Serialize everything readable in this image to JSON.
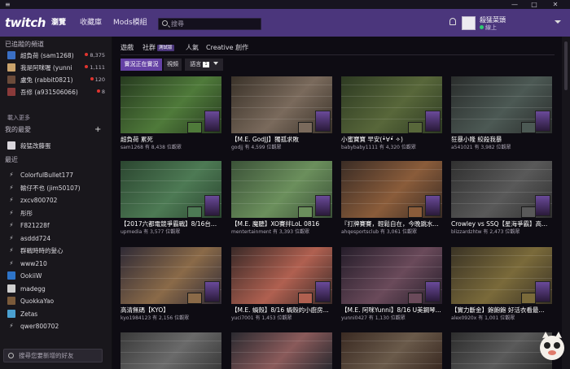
{
  "window": {
    "menu_icon": "≡",
    "minimize": "—",
    "maximize": "□",
    "close": "✕"
  },
  "topnav": {
    "logo": "twitch",
    "links": [
      "瀏覽",
      "收藏庫",
      "Mods模組"
    ],
    "search_placeholder": "搜尋",
    "user": {
      "name": "殺猛菜頭",
      "status": "線上"
    }
  },
  "sidebar": {
    "followed_header": "已追蹤的頻道",
    "followed": [
      {
        "name": "超負荷 (sam1268)",
        "count": "8,375",
        "color": "#3a6fc4"
      },
      {
        "name": "我是阿咪喔 (yunni",
        "count": "1,111",
        "color": "#caa36c"
      },
      {
        "name": "盧兔 (rabbit0821)",
        "count": "120",
        "color": "#6b4b3a"
      },
      {
        "name": "吾修 (a931506066)",
        "count": "8",
        "color": "#8a3a3a"
      }
    ],
    "more_label": "載入更多",
    "favorites_header": "我的最愛",
    "favorites": [
      {
        "name": "殺猛改藤蛋",
        "color": "#d9d6dc"
      }
    ],
    "recent_header": "最近",
    "recent": [
      {
        "name": "ColorfulBullet177",
        "icon": "bolt"
      },
      {
        "name": "輸仔不也 (jim50107)",
        "icon": "bolt"
      },
      {
        "name": "zxcv800702",
        "icon": "bolt"
      },
      {
        "name": "彤彤",
        "icon": "bolt"
      },
      {
        "name": "F821228f",
        "icon": "bolt"
      },
      {
        "name": "asddd724",
        "icon": "bolt"
      },
      {
        "name": "群戰時時的髮心",
        "icon": "bolt"
      },
      {
        "name": "www210",
        "icon": "bolt"
      },
      {
        "name": "OokiiW",
        "icon": "avatar",
        "color": "#2e74c8"
      },
      {
        "name": "madegg",
        "icon": "avatar",
        "color": "#cfcfcf"
      },
      {
        "name": "QuokkaYao",
        "icon": "avatar",
        "color": "#7a5a3a"
      },
      {
        "name": "Zetas",
        "icon": "avatar",
        "color": "#4aa0d0"
      },
      {
        "name": "qwer800702",
        "icon": "bolt"
      }
    ],
    "friend_search_placeholder": "搜尋您要新增的好友"
  },
  "main": {
    "tabs": [
      "遊戲",
      "社群",
      "人氣",
      "Creative 創作"
    ],
    "tab_badge": "測試版",
    "filters": {
      "live": "實況正在實況",
      "video": "視頻",
      "language": "語言",
      "language_count": "1"
    },
    "streams": [
      {
        "title": "超負荷 累死",
        "meta": "sam1268 有 8,438 位觀眾",
        "bg": "#263a1f",
        "accent": "#4f7a3a"
      },
      {
        "title": "【M.E. GodJJ】獨孤求敗",
        "meta": "godjj 有 4,599 位觀眾",
        "bg": "#3a3229",
        "accent": "#7a6a5c"
      },
      {
        "title": "小蜜寶寶 早安(•̀∀•́ ✧)",
        "meta": "babybaby1111 有 4,320 位觀眾",
        "bg": "#2d3a22",
        "accent": "#58673a"
      },
      {
        "title": "狂暴小隆 絞殺我暴",
        "meta": "a541021 有 3,982 位觀眾",
        "bg": "#2a2d2c",
        "accent": "#4c5954"
      },
      {
        "title": "【2017六都電競爭霸戰】8/16台...",
        "meta": "upmedia 有 3,577 位觀眾",
        "bg": "#2b4630",
        "accent": "#4d7a54"
      },
      {
        "title": "【M.E. 魔聽】XO賽拌LoL 0816",
        "meta": "mentertainment 有 3,393 位觀眾",
        "bg": "#3b5238",
        "accent": "#6b8f5c"
      },
      {
        "title": "『打牌賽賽，輕鬆自在，今晚跳水...",
        "meta": "ahqesportsclub 有 3,061 位觀眾",
        "bg": "#3a2c25",
        "accent": "#8a5c3a"
      },
      {
        "title": "Crowley vs SSQ【星海爭霸】高...",
        "meta": "blizzardzhtw 有 2,473 位觀眾",
        "bg": "#303030",
        "accent": "#595959"
      },
      {
        "title": "高清無碼【KYO】",
        "meta": "kyo1984123 有 2,156 位觀眾",
        "bg": "#2f2a36",
        "accent": "#8a6a48"
      },
      {
        "title": "【M.E. 蝸殼】8/16 蝸殼的小廚房...",
        "meta": "yuci7001 有 1,453 位觀眾",
        "bg": "#3a2a28",
        "accent": "#b06050"
      },
      {
        "title": "【M.E. 阿咪Yunni】8/16 U美鋼琴...",
        "meta": "yunni0427 有 1,130 位觀眾",
        "bg": "#251d2a",
        "accent": "#6a4a5a"
      },
      {
        "title": "【實力斷金】飽飽飽 好活衣看最...",
        "meta": "alex0920x 有 1,001 位觀眾",
        "bg": "#3a3325",
        "accent": "#7a6a3a"
      },
      {
        "title": "",
        "meta": "",
        "bg": "#3a3a3a",
        "accent": "#6a6a6a"
      },
      {
        "title": "",
        "meta": "",
        "bg": "#2b2a30",
        "accent": "#8a5a5a"
      },
      {
        "title": "",
        "meta": "",
        "bg": "#3a2a22",
        "accent": "#6a5a4a"
      },
      {
        "title": "",
        "meta": "",
        "bg": "#2d2d2d",
        "accent": "#5a5a5a"
      }
    ]
  }
}
